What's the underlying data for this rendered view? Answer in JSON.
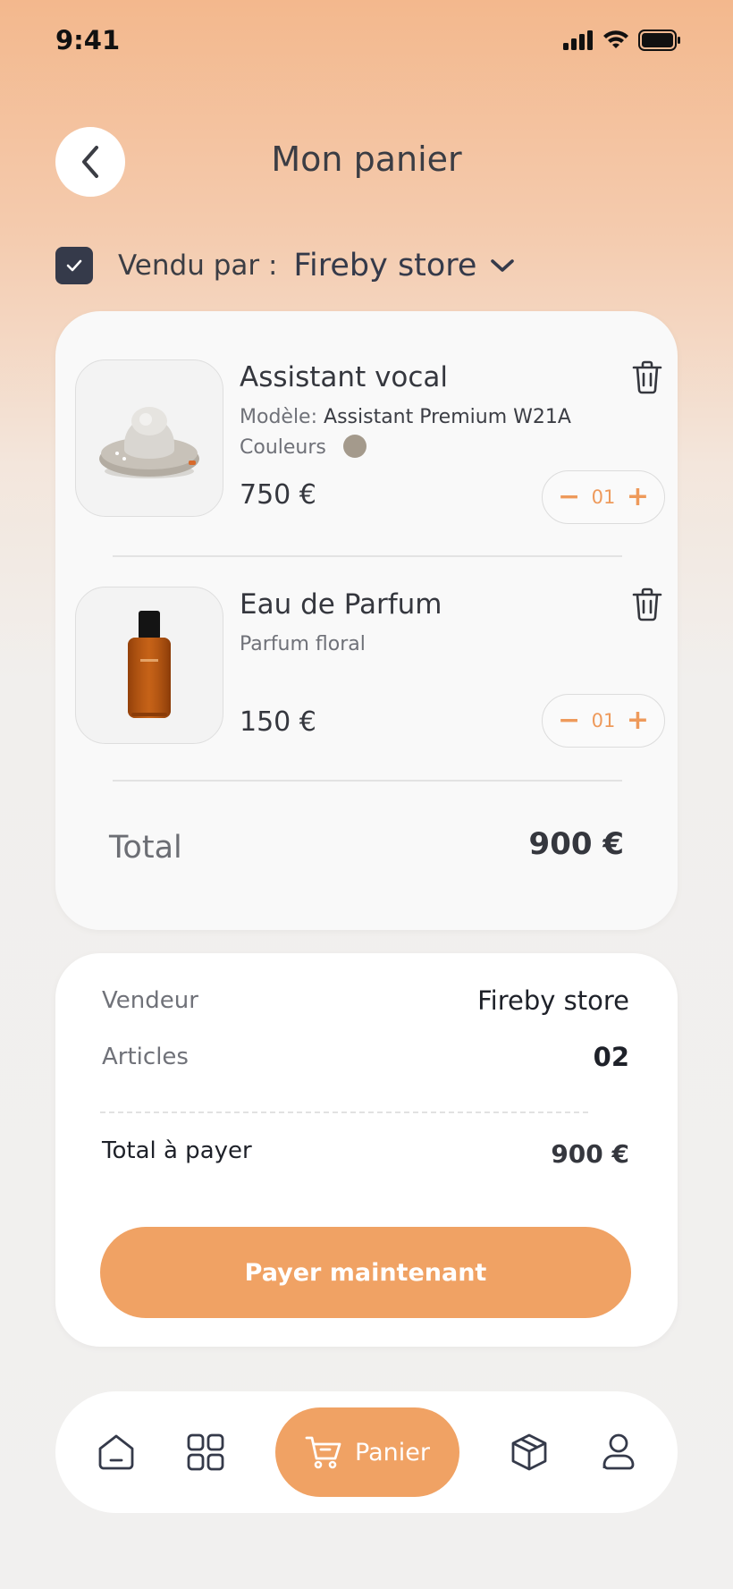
{
  "status_bar": {
    "time": "9:41"
  },
  "header": {
    "title": "Mon panier"
  },
  "vendor": {
    "label": "Vendu par :",
    "name": "Fireby store",
    "checked": true
  },
  "cart": {
    "items": [
      {
        "name": "Assistant vocal",
        "meta_label": "Modèle:",
        "meta_value": "Assistant Premium W21A",
        "color_label": "Couleurs",
        "color_hex": "#a49a8c",
        "price": "750 €",
        "quantity": "01",
        "image": "smart-speaker-image"
      },
      {
        "name": "Eau de Parfum",
        "subtitle": "Parfum floral",
        "price": "150 €",
        "quantity": "01",
        "image": "perfume-bottle-image"
      }
    ],
    "total_label": "Total",
    "total_value": "900 €"
  },
  "summary": {
    "seller_label": "Vendeur",
    "seller_value": "Fireby store",
    "articles_label": "Articles",
    "articles_value": "02",
    "pay_total_label": "Total à payer",
    "pay_total_value": "900 €",
    "pay_button": "Payer maintenant"
  },
  "tabbar": {
    "active_label": "Panier",
    "icons": [
      "home-icon",
      "grid-icon",
      "cart-icon",
      "box-icon",
      "user-icon"
    ]
  },
  "colors": {
    "accent": "#f0a264",
    "dark": "#353a4a",
    "card": "#f9f9f9"
  }
}
